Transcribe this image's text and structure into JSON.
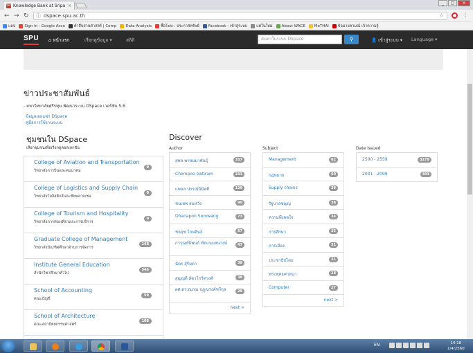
{
  "browser": {
    "tab_title": "Knowledge Bank at Sripa",
    "tab_close": "×",
    "favicon_text": "SPU",
    "url": "dspace.spu.ac.th",
    "window_buttons": [
      "_",
      "▢",
      "✕"
    ],
    "bookmarks": [
      {
        "label": "แอป",
        "color": "#4285f4"
      },
      {
        "label": "Sign in - Google Acco",
        "color": "#db4437"
      },
      {
        "label": "ตำสืบสานศาสตร์ | Comp",
        "color": "#333333"
      },
      {
        "label": "Data Analysis",
        "color": "#f4b400"
      },
      {
        "label": "ซื้อโฆษ : ประกาศทรัพย์",
        "color": "#e53935"
      },
      {
        "label": "Facebook - เข้าสู่ระบบ",
        "color": "#3b5998"
      },
      {
        "label": "แต่ในใหม่",
        "color": "#888888"
      },
      {
        "label": "About WACE",
        "color": "#6aa84f"
      },
      {
        "label": "MeTHAI",
        "color": "#f1c232"
      },
      {
        "label": "ข้อมายควมณ์ เจ้าความรู้",
        "color": "#cc0000"
      }
    ]
  },
  "nav": {
    "brand": "SPU",
    "home": "หน้าแรก",
    "browse": "เรียกดูข้อมูล ▾",
    "stats": "สถิติ",
    "search_placeholder": "ค้นหาในระบบ DSpace",
    "search_icon": "search-icon",
    "login": "เข้าสู่ระบบ ▾",
    "language": "Language ▾"
  },
  "news": {
    "title": "ข่าวประชาสัมพันธ์",
    "body": "- มหาวิทยาลัยศรีปทุม พัฒนาระบบ DSpace เวอร์ชัน 5.6",
    "link1": "ข้อมูลเผยแพร่ DSpace",
    "link2": "คู่มือการใช้งานระบบ"
  },
  "communities": {
    "title": "ชุมชนใน DSpace",
    "subtitle": "เลือกชุมชนเพื่อเรียกดูคอลเลกชัน",
    "items": [
      {
        "name": "College of Aviation and Transportation",
        "desc": "วิทยาลัยการบินและคมนาคม",
        "count": "0"
      },
      {
        "name": "College of Logistics and Supply Chain",
        "desc": "วิทยาลัยโลจิสติกส์และซัพพลายเชน",
        "count": "0"
      },
      {
        "name": "College of Tourism and Hospitality",
        "desc": "วิทยาลัยการท่องเที่ยวและการบริการ",
        "count": "0"
      },
      {
        "name": "Graduate College of Management",
        "desc": "วิทยาลัยบัณฑิตศึกษาด้านการจัดการ",
        "count": "148"
      },
      {
        "name": "Institute General Education",
        "desc": "สำนักวิชาศึกษาทั่วไป",
        "count": "546"
      },
      {
        "name": "School of Accounting",
        "desc": "คณะบัญชี",
        "count": "59"
      },
      {
        "name": "School of Architecture",
        "desc": "คณะสถาปัตยกรรมศาสตร์",
        "count": "108"
      }
    ]
  },
  "discover": {
    "title": "Discover",
    "author_label": "Author",
    "subject_label": "Subject",
    "date_label": "Date issued",
    "authors": [
      {
        "label": "สุพล พรหมมาพันธุ์",
        "count": "337"
      },
      {
        "label": "Chompoo Gotiram",
        "count": "233"
      },
      {
        "label": "แพลล ปกรณ์นิมิตดี",
        "count": "129"
      },
      {
        "label": "ชนเทพ สมหวัง",
        "count": "90"
      },
      {
        "label": "Dhanapon Somwang",
        "count": "73"
      },
      {
        "label": "ชลฤช โกษลินธ์",
        "count": "67"
      },
      {
        "label": "การุณย์นิพนธ์ ขัดแนมสนวงษ์",
        "count": "47"
      },
      {
        "label": "ฉัตร สุริมดา",
        "count": "38"
      },
      {
        "label": "สุญญดี ผัดวโกวิทวงศ์",
        "count": "38"
      },
      {
        "label": "ผศ.ดร.ณภณ ปฏุณรงค์ทวีกุล",
        "count": "29"
      }
    ],
    "authors_more": "next >",
    "subjects": [
      {
        "label": "Management",
        "count": "62"
      },
      {
        "label": "กฎหมาย",
        "count": "60"
      },
      {
        "label": "Supply chains",
        "count": "39"
      },
      {
        "label": "รัฐบาลชญญ",
        "count": "38"
      },
      {
        "label": "ความพึงพอใจ",
        "count": "34"
      },
      {
        "label": "การศึกษา",
        "count": "32"
      },
      {
        "label": "การเมือง",
        "count": "31"
      },
      {
        "label": "ประชาธิปไตย",
        "count": "31"
      },
      {
        "label": "พระพุทธศาสนา",
        "count": "28"
      },
      {
        "label": "Computer",
        "count": "27"
      }
    ],
    "subjects_more": "next >",
    "dates": [
      {
        "label": "2500 - 2559",
        "count": "3279"
      },
      {
        "label": "2001 - 2099",
        "count": "303"
      }
    ]
  },
  "taskbar": {
    "language": "EN",
    "time": "14:18",
    "date": "1/4/2560"
  }
}
